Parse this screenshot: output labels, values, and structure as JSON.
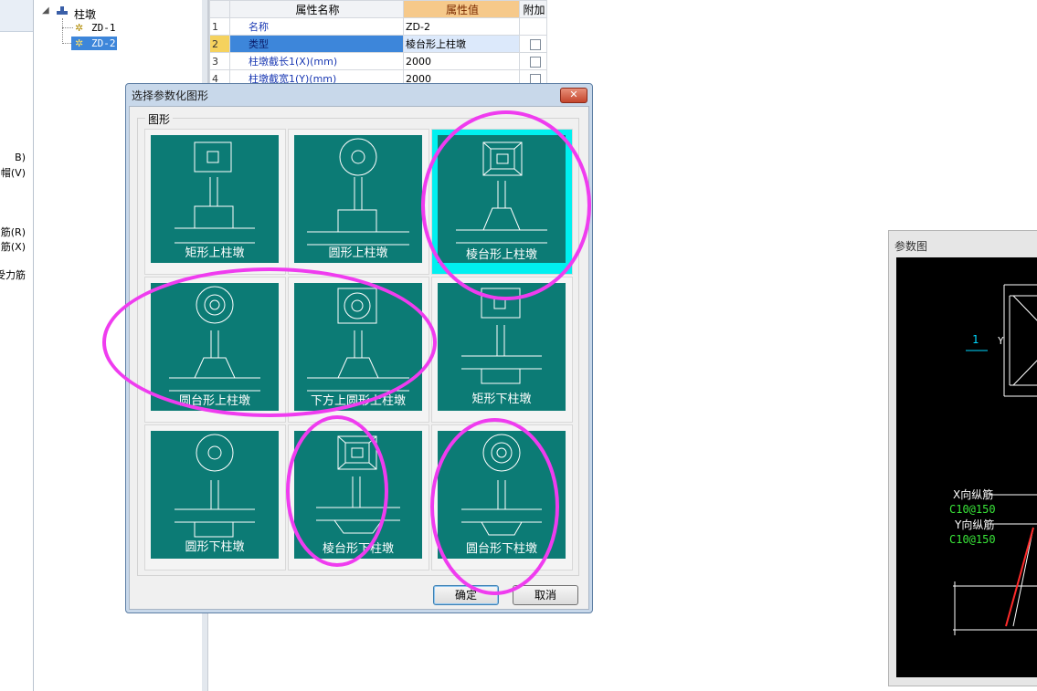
{
  "left_strip": {
    "labels": [
      "B)",
      "帽(V)",
      "筋(R)",
      "筋(X)",
      "受力筋"
    ]
  },
  "tree": {
    "root": "柱墩",
    "items": [
      "ZD-1",
      "ZD-2"
    ],
    "selected": "ZD-2"
  },
  "grid": {
    "headers": {
      "name": "属性名称",
      "value": "属性值",
      "extra": "附加"
    },
    "rows": [
      {
        "idx": "1",
        "name": "名称",
        "value": "ZD-2"
      },
      {
        "idx": "2",
        "name": "类型",
        "value": "棱台形上柱墩"
      },
      {
        "idx": "3",
        "name": "柱墩截长1(X)(mm)",
        "value": "2000"
      },
      {
        "idx": "4",
        "name": "柱墩截宽1(Y)(mm)",
        "value": "2000"
      }
    ]
  },
  "dialog": {
    "title": "选择参数化图形",
    "close_label": "✕",
    "group_label": "图形",
    "shapes": [
      "矩形上柱墩",
      "圆形上柱墩",
      "棱台形上柱墩",
      "圆台形上柱墩",
      "下方上圆形上柱墩",
      "矩形下柱墩",
      "圆形下柱墩",
      "棱台形下柱墩",
      "圆台形下柱墩"
    ],
    "selected_shape": "棱台形上柱墩",
    "ok_label": "确定",
    "cancel_label": "取消"
  },
  "param_panel": {
    "title": "参数图",
    "marker": "1",
    "axis_y": "Y",
    "x_rebar_label": "X向纵筋",
    "x_rebar_value": "C10@150",
    "y_rebar_label": "Y向纵筋",
    "y_rebar_value": "C10@150"
  },
  "colors": {
    "tile_bg": "#0c7b75",
    "selection": "#00f0f0",
    "annotation": "#ef3cef"
  }
}
